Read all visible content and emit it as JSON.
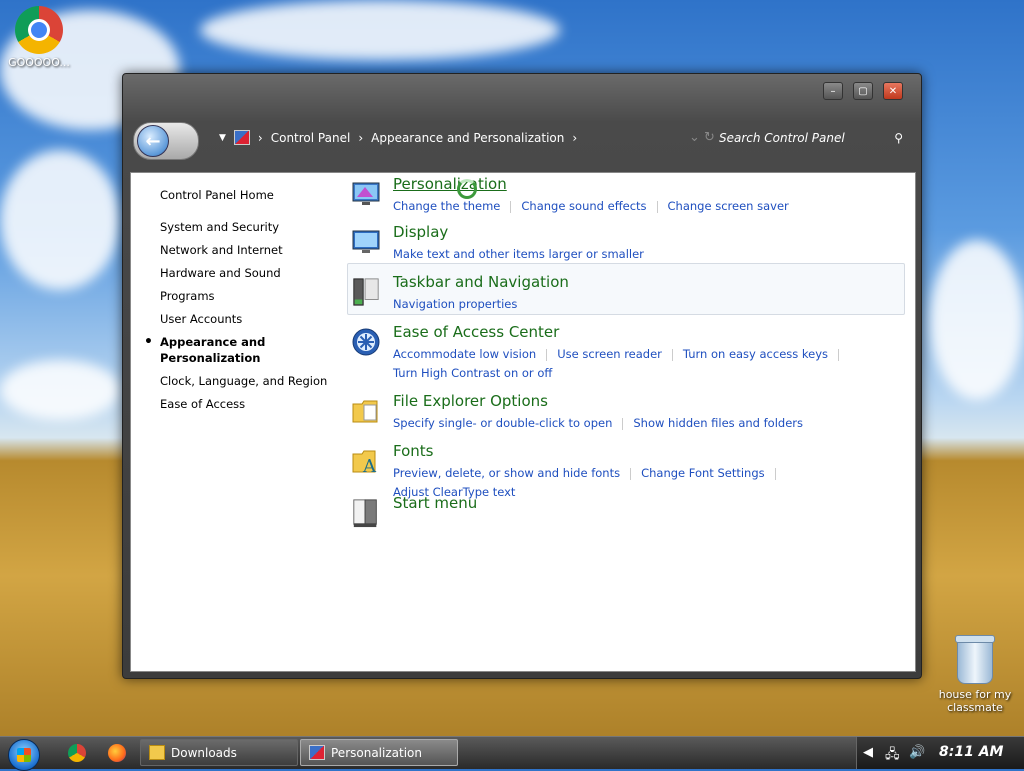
{
  "desktop": {
    "icons": [
      {
        "label": "GOOOOO..."
      },
      {
        "label": "house for my classmate"
      }
    ]
  },
  "window": {
    "controls": {
      "minimize": "–",
      "maximize": "▢",
      "close": "✕"
    },
    "breadcrumb": [
      "Control Panel",
      "Appearance and Personalization"
    ],
    "search_placeholder": "Search Control Panel"
  },
  "left_nav": {
    "home": "Control Panel Home",
    "items": [
      "System and Security",
      "Network and Internet",
      "Hardware and Sound",
      "Programs",
      "User Accounts",
      "Appearance and Personalization",
      "Clock, Language, and Region",
      "Ease of Access"
    ],
    "active_index": 5
  },
  "categories": [
    {
      "title": "Personalization",
      "links": [
        "Change the theme",
        "Change sound effects",
        "Change screen saver"
      ],
      "icon": "personalization-icon"
    },
    {
      "title": "Display",
      "links": [
        "Make text and other items larger or smaller"
      ],
      "icon": "display-icon"
    },
    {
      "title": "Taskbar and Navigation",
      "links": [
        "Navigation properties"
      ],
      "icon": "taskbar-icon"
    },
    {
      "title": "Ease of Access Center",
      "links": [
        "Accommodate low vision",
        "Use screen reader",
        "Turn on easy access keys",
        "Turn High Contrast on or off"
      ],
      "icon": "ease-of-access-icon"
    },
    {
      "title": "File Explorer Options",
      "links": [
        "Specify single- or double-click to open",
        "Show hidden files and folders"
      ],
      "icon": "folder-options-icon"
    },
    {
      "title": "Fonts",
      "links": [
        "Preview, delete, or show and hide fonts",
        "Change Font Settings",
        "Adjust ClearType text"
      ],
      "icon": "fonts-icon"
    },
    {
      "title": "Start menu",
      "links": [],
      "icon": "start-menu-icon"
    }
  ],
  "taskbar": {
    "buttons": [
      {
        "label": "Downloads"
      },
      {
        "label": "Personalization"
      }
    ],
    "clock": "8:11 AM"
  },
  "colors": {
    "link": "#1f4fbf",
    "category_title": "#1a6d1a"
  }
}
